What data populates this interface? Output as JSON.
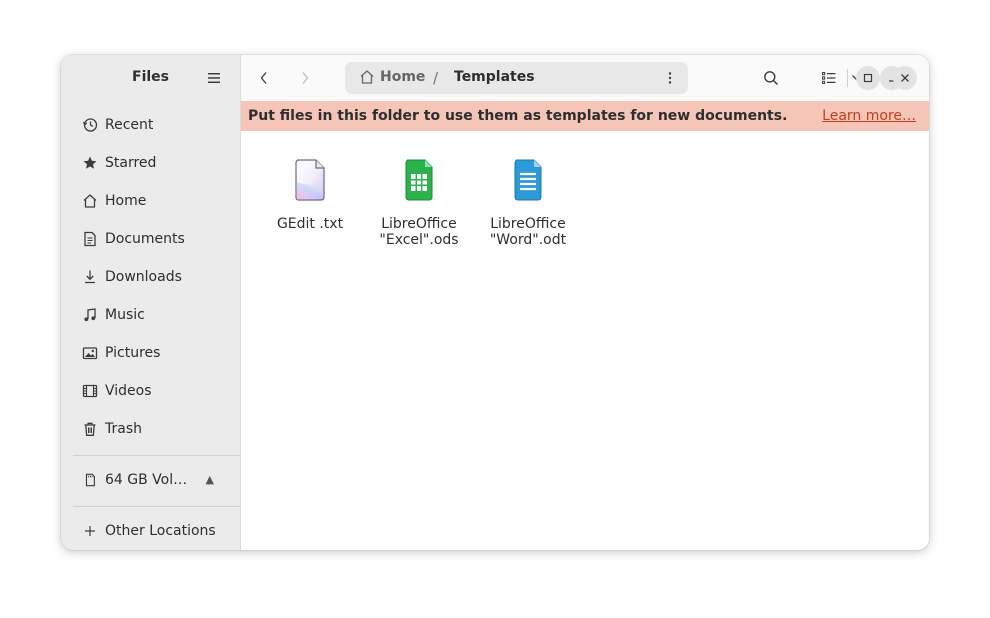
{
  "app": {
    "title": "Files"
  },
  "sidebar": {
    "items": [
      {
        "label": "Recent",
        "icon": "clock-icon"
      },
      {
        "label": "Starred",
        "icon": "star-icon"
      },
      {
        "label": "Home",
        "icon": "home-icon"
      },
      {
        "label": "Documents",
        "icon": "document-icon"
      },
      {
        "label": "Downloads",
        "icon": "download-icon"
      },
      {
        "label": "Music",
        "icon": "music-note-icon"
      },
      {
        "label": "Pictures",
        "icon": "picture-icon"
      },
      {
        "label": "Videos",
        "icon": "film-icon"
      },
      {
        "label": "Trash",
        "icon": "trash-icon"
      }
    ],
    "volume": {
      "label": "64 GB Vol…",
      "icon": "sd-card-icon",
      "eject_icon": "eject-icon"
    },
    "other_locations": {
      "label": "Other Locations",
      "icon": "plus-icon"
    }
  },
  "pathbar": {
    "home_label": "Home",
    "separator": "/",
    "current": "Templates"
  },
  "infobar": {
    "message": "Put files in this folder to use them as templates for new documents.",
    "link": "Learn more…",
    "color": "#f5c5b8"
  },
  "files": [
    {
      "name": "GEdit .txt",
      "icon": "text-file-icon"
    },
    {
      "name": "LibreOffice\n\"Excel\".ods",
      "icon": "spreadsheet-icon"
    },
    {
      "name": "LibreOffice\n\"Word\".odt",
      "icon": "text-document-icon"
    }
  ]
}
